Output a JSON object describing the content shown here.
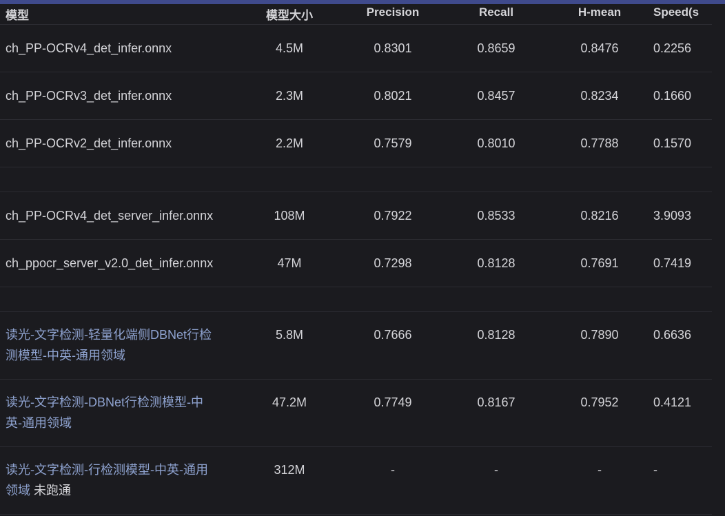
{
  "table": {
    "headers": [
      "模型",
      "模型大小",
      "Precision",
      "Recall",
      "H-mean",
      "Speed(s"
    ],
    "rows": [
      {
        "model": "ch_PP-OCRv4_det_infer.onnx",
        "size": "4.5M",
        "precision": "0.8301",
        "recall": "0.8659",
        "hmean": "0.8476",
        "speed": "0.2256"
      },
      {
        "model": "ch_PP-OCRv3_det_infer.onnx",
        "size": "2.3M",
        "precision": "0.8021",
        "recall": "0.8457",
        "hmean": "0.8234",
        "speed": "0.1660"
      },
      {
        "model": "ch_PP-OCRv2_det_infer.onnx",
        "size": "2.2M",
        "precision": "0.7579",
        "recall": "0.8010",
        "hmean": "0.7788",
        "speed": "0.1570"
      },
      {
        "model": "ch_PP-OCRv4_det_server_infer.onnx",
        "size": "108M",
        "precision": "0.7922",
        "recall": "0.8533",
        "hmean": "0.8216",
        "speed": "3.9093"
      },
      {
        "model": "ch_ppocr_server_v2.0_det_infer.onnx",
        "size": "47M",
        "precision": "0.7298",
        "recall": "0.8128",
        "hmean": "0.7691",
        "speed": "0.7419"
      },
      {
        "model": "读光-文字检测-轻量化端侧DBNet行检测模型-中英-通用领域",
        "size": "5.8M",
        "precision": "0.7666",
        "recall": "0.8128",
        "hmean": "0.7890",
        "speed": "0.6636"
      },
      {
        "model": "读光-文字检测-DBNet行检测模型-中英-通用领域",
        "size": "47.2M",
        "precision": "0.7749",
        "recall": "0.8167",
        "hmean": "0.7952",
        "speed": "0.4121"
      },
      {
        "model": "读光-文字检测-行检测模型-中英-通用领域",
        "note": "未跑通",
        "size": "312M",
        "precision": "-",
        "recall": "-",
        "hmean": "-",
        "speed": "-"
      }
    ]
  },
  "colors": {
    "background": "#1b1b1f",
    "text": "#d4d4d8",
    "link": "#8ea2cf",
    "accent_bar": "#3f4a8c",
    "divider": "#2c2c32"
  }
}
